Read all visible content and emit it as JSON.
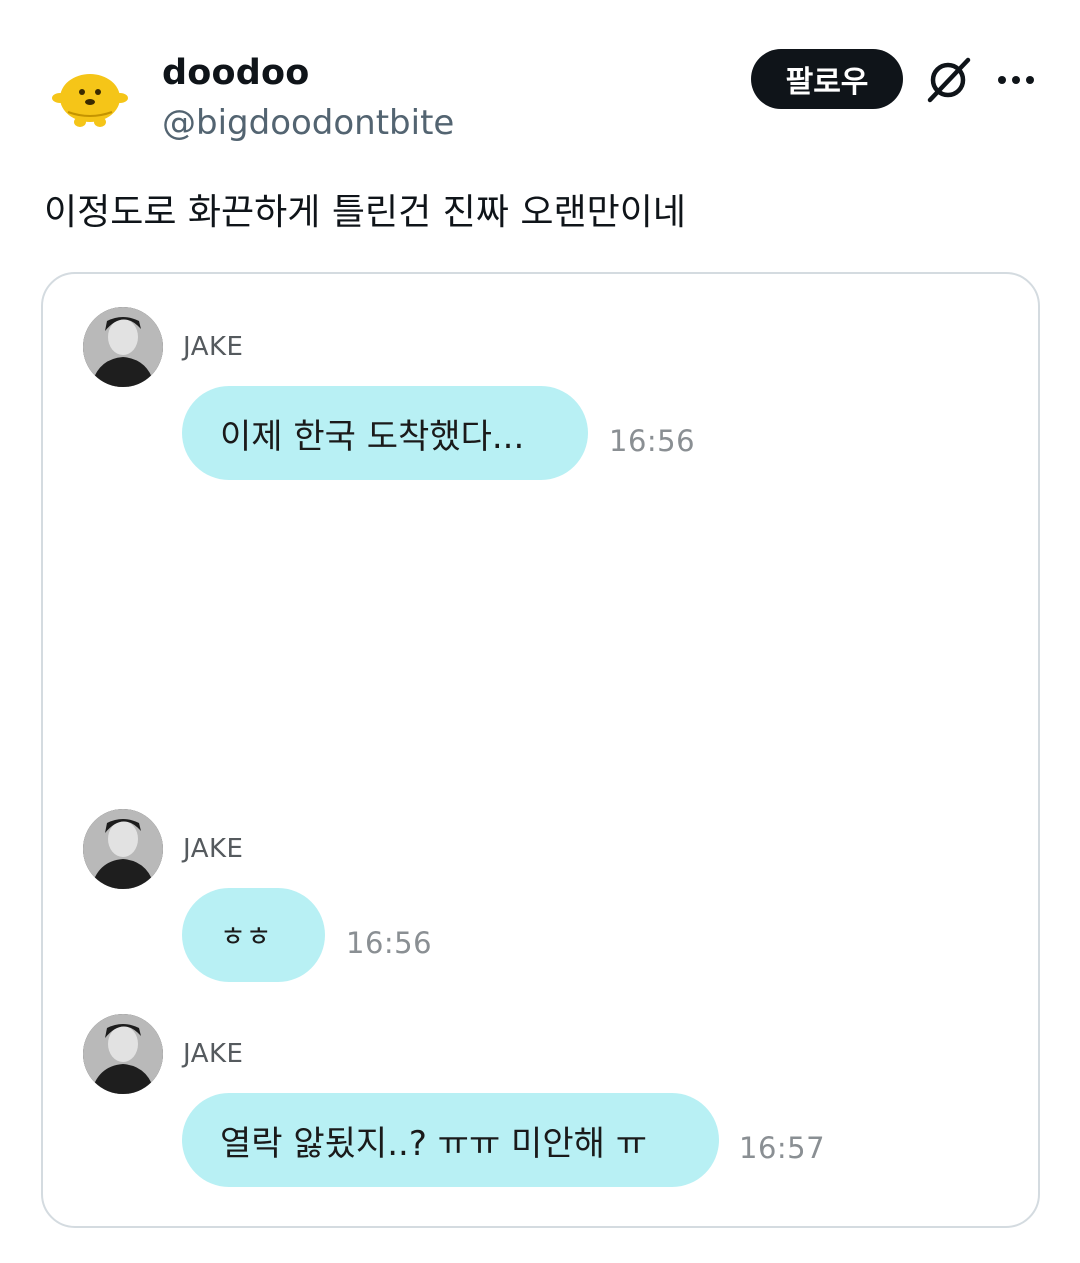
{
  "post": {
    "display_name": "doodoo",
    "handle": "@bigdoodontbite",
    "follow_label": "팔로우",
    "text": "이정도로 화끈하게 틀린건 진짜 오랜만이네",
    "avatar_icon": "yellow-character-icon",
    "grok_icon": "grok-icon",
    "more_icon": "more-dots-icon",
    "colors": {
      "follow_bg": "#0f1419",
      "handle": "#536471",
      "bubble": "#b8f0f4"
    }
  },
  "chat": {
    "messages": [
      {
        "sender": "JAKE",
        "text": "이제 한국 도착했다...",
        "time": "16:56"
      },
      {
        "sender": "JAKE",
        "text": "ㅎㅎ",
        "time": "16:56"
      },
      {
        "sender": "JAKE",
        "text": "열락 앓됬지..? ㅠㅠ 미안해 ㅠ",
        "time": "16:57"
      }
    ]
  }
}
